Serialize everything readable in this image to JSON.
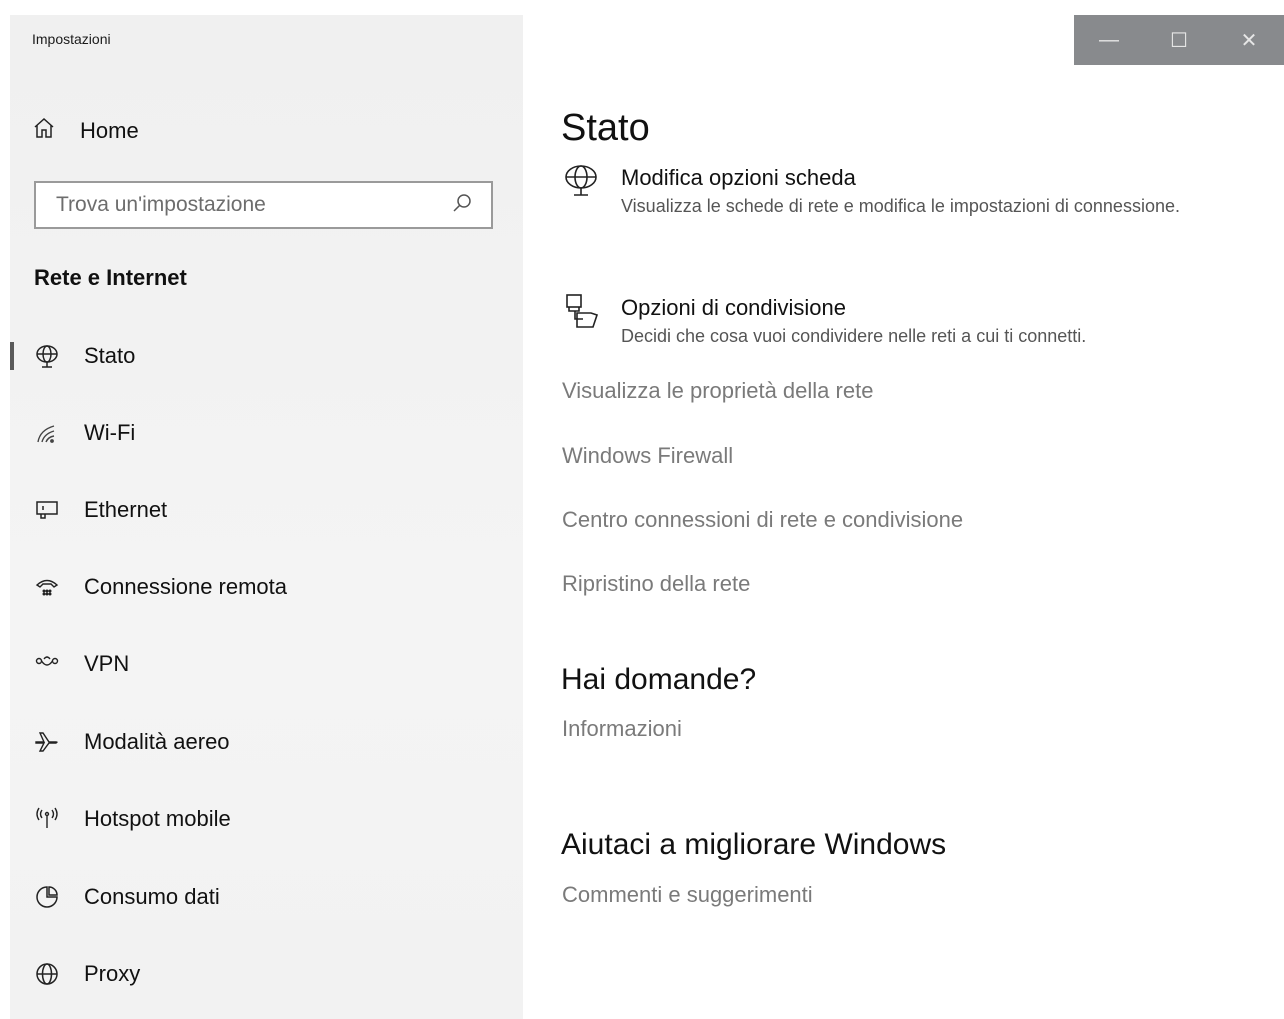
{
  "window": {
    "title": "Impostazioni"
  },
  "sidebar": {
    "home_label": "Home",
    "search_placeholder": "Trova un'impostazione",
    "section_title": "Rete e Internet",
    "items": [
      {
        "label": "Stato",
        "icon": "globe-network-icon",
        "active": true
      },
      {
        "label": "Wi-Fi",
        "icon": "wifi-icon"
      },
      {
        "label": "Ethernet",
        "icon": "ethernet-icon"
      },
      {
        "label": "Connessione remota",
        "icon": "dialup-icon"
      },
      {
        "label": "VPN",
        "icon": "vpn-icon"
      },
      {
        "label": "Modalità aereo",
        "icon": "airplane-icon"
      },
      {
        "label": "Hotspot mobile",
        "icon": "hotspot-icon"
      },
      {
        "label": "Consumo dati",
        "icon": "data-usage-icon"
      },
      {
        "label": "Proxy",
        "icon": "proxy-globe-icon"
      }
    ]
  },
  "titlebar": {
    "minimize": "—",
    "maximize": "☐",
    "close": "✕"
  },
  "main": {
    "title": "Stato",
    "options": [
      {
        "title": "Modifica opzioni scheda",
        "desc": "Visualizza le schede di rete e modifica le impostazioni di connessione.",
        "icon": "adapter-icon"
      },
      {
        "title": "Opzioni di condivisione",
        "desc": "Decidi che cosa vuoi condividere nelle reti a cui ti connetti.",
        "icon": "sharing-icon"
      }
    ],
    "links": [
      "Visualizza le proprietà della rete",
      "Windows Firewall",
      "Centro connessioni di rete e condivisione",
      "Ripristino della rete"
    ],
    "questions_title": "Hai domande?",
    "questions_link": "Informazioni",
    "improve_title": "Aiutaci a migliorare Windows",
    "improve_link": "Commenti e suggerimenti"
  }
}
